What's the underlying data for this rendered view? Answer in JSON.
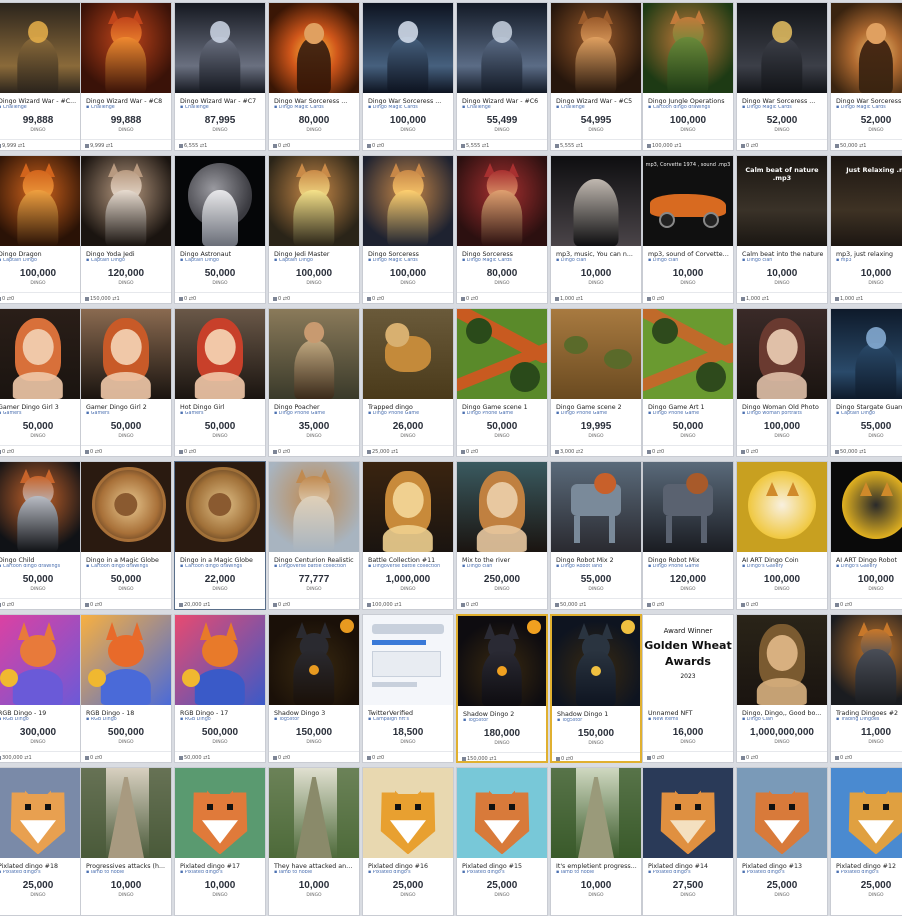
{
  "rows": [
    [
      {
        "title": "Dingo Wizard War - #C...",
        "collection": "Challenge",
        "price": "99,888",
        "unit": "DINGO",
        "foot": "9,999 ⇄1",
        "art": "wizard",
        "c": [
          "#2b241c",
          "#8a6a3a",
          "#e8b04a"
        ]
      },
      {
        "title": "Dingo Wizard War - #C8",
        "collection": "Challenge",
        "price": "99,888",
        "unit": "DINGO",
        "foot": "9,999 ⇄1",
        "art": "fox",
        "c": [
          "#3a1208",
          "#c0441a",
          "#f08a30"
        ]
      },
      {
        "title": "Dingo Wizard War - #C7",
        "collection": "Challenge",
        "price": "87,995",
        "unit": "DINGO",
        "foot": "6,555 ⇄1",
        "art": "wizard",
        "c": [
          "#151820",
          "#6a7080",
          "#cfd8e8"
        ]
      },
      {
        "title": "Dingo War Sorceress ...",
        "collection": "Dingo Magic Cards",
        "price": "80,000",
        "unit": "DINGO",
        "foot": "0 ⇄0",
        "art": "fire",
        "c": [
          "#3a1605",
          "#d0561a",
          "#ffc340"
        ]
      },
      {
        "title": "Dingo War Sorceress ...",
        "collection": "Dingo Magic Cards",
        "price": "100,000",
        "unit": "DINGO",
        "foot": "0 ⇄0",
        "art": "wizard",
        "c": [
          "#0d1320",
          "#46607e",
          "#d8e2f0"
        ]
      },
      {
        "title": "Dingo Wizard War - #C6",
        "collection": "Challenge",
        "price": "55,499",
        "unit": "DINGO",
        "foot": "5,555 ⇄1",
        "art": "wizard",
        "c": [
          "#131a26",
          "#5b6c86",
          "#c8d2e0"
        ]
      },
      {
        "title": "Dingo Wizard War - #C5",
        "collection": "Challenge",
        "price": "54,995",
        "unit": "DINGO",
        "foot": "5,555 ⇄1",
        "art": "fox",
        "c": [
          "#26160c",
          "#9a5a2a",
          "#e0a060"
        ]
      },
      {
        "title": "Dingo Jungle Operations",
        "collection": "Cartoon dingo drawings",
        "price": "100,000",
        "unit": "DINGO",
        "foot": "100,000 ⇄1",
        "art": "fox",
        "c": [
          "#1d3a14",
          "#c27a3a",
          "#6a8a3a"
        ]
      },
      {
        "title": "Dingo War Sorceress ...",
        "collection": "Dingo Magic Cards",
        "price": "52,000",
        "unit": "DINGO",
        "foot": "0 ⇄0",
        "art": "wizard",
        "c": [
          "#121418",
          "#3c3f48",
          "#e6c060"
        ]
      },
      {
        "title": "Dingo War Sorceress",
        "collection": "Dingo Magic Cards",
        "price": "52,000",
        "unit": "DINGO",
        "foot": "50,000 ⇄1",
        "art": "fire",
        "c": [
          "#3a2410",
          "#b06a30",
          "#f0c070"
        ]
      }
    ],
    [
      {
        "title": "Dingo Dragon",
        "collection": "Captain Dingo",
        "price": "100,000",
        "unit": "DINGO",
        "foot": "0 ⇄0",
        "art": "fox",
        "c": [
          "#2a1206",
          "#d2641c",
          "#f0a040"
        ]
      },
      {
        "title": "Dingo Yoda Jedi",
        "collection": "Captain Dingo",
        "price": "120,000",
        "unit": "DINGO",
        "foot": "150,000 ⇄1",
        "art": "fox",
        "c": [
          "#1a1410",
          "#b89a80",
          "#e8dcd0"
        ]
      },
      {
        "title": "Dingo Astronaut",
        "collection": "Captain Dingo",
        "price": "50,000",
        "unit": "DINGO",
        "foot": "0 ⇄0",
        "art": "space",
        "c": [
          "#050608",
          "#6a6e78",
          "#e8e8ea"
        ]
      },
      {
        "title": "Dingo Jedi Master",
        "collection": "Captain Dingo",
        "price": "100,000",
        "unit": "DINGO",
        "foot": "0 ⇄0",
        "art": "fox",
        "c": [
          "#2a2418",
          "#c98a48",
          "#f6e28a"
        ]
      },
      {
        "title": "Dingo Sorceress",
        "collection": "Dingo Magic Cards",
        "price": "100,000",
        "unit": "DINGO",
        "foot": "0 ⇄0",
        "art": "fox",
        "c": [
          "#1e2230",
          "#c88848",
          "#ffd070"
        ]
      },
      {
        "title": "Dingo Sorceress",
        "collection": "Dingo Magic Cards",
        "price": "80,000",
        "unit": "DINGO",
        "foot": "0 ⇄0",
        "art": "fox",
        "c": [
          "#2c1010",
          "#a83030",
          "#e0a070"
        ]
      },
      {
        "title": "mp3, music, You can n...",
        "collection": "Dingo clan",
        "price": "10,000",
        "unit": "DINGO",
        "foot": "1,000 ⇄1",
        "art": "dark",
        "c": [
          "#0e0e10",
          "#4a4448",
          "#c0b8b0"
        ]
      },
      {
        "title": "mp3, sound of Corvette ...",
        "collection": "Dingo clan",
        "price": "10,000",
        "unit": "DINGO",
        "foot": "0 ⇄0",
        "art": "car",
        "c": [
          "#101010",
          "#d86a20",
          "#f0f0f0"
        ]
      },
      {
        "title": "Calm beat into the nature",
        "collection": "Dingo clan",
        "price": "10,000",
        "unit": "DINGO",
        "foot": "1,000 ⇄1",
        "art": "textdark",
        "c": [
          "#1a1612",
          "#3a3228",
          "#ffffff"
        ],
        "txt": "Calm beat of nature .mp3"
      },
      {
        "title": "mp3, just relaxing",
        "collection": "mp3",
        "price": "10,000",
        "unit": "DINGO",
        "foot": "1,000 ⇄1",
        "art": "textdark",
        "c": [
          "#1c1612",
          "#3e3224",
          "#ffffff"
        ],
        "txt": "Just Relaxing .m"
      }
    ],
    [
      {
        "title": "Gamer Dingo Girl 3",
        "collection": "Gamers",
        "price": "50,000",
        "unit": "DINGO",
        "foot": "0 ⇄0",
        "art": "girl",
        "c": [
          "#2a1e18",
          "#d8703a",
          "#f0c8a8"
        ]
      },
      {
        "title": "Gamer Dingo Girl 2",
        "collection": "Gamers",
        "price": "50,000",
        "unit": "DINGO",
        "foot": "0 ⇄0",
        "art": "girl",
        "c": [
          "#8a6a50",
          "#c85a28",
          "#f0c8a8"
        ]
      },
      {
        "title": "Hot Dingo Girl",
        "collection": "Gamers",
        "price": "50,000",
        "unit": "DINGO",
        "foot": "0 ⇄0",
        "art": "girl",
        "c": [
          "#6a5848",
          "#c8402a",
          "#f2c8a8"
        ]
      },
      {
        "title": "Dingo Poacher",
        "collection": "Dingo Phone Game",
        "price": "35,000",
        "unit": "DINGO",
        "foot": "0 ⇄0",
        "art": "man",
        "c": [
          "#3a3a2a",
          "#8a7a5a",
          "#c0a880"
        ]
      },
      {
        "title": "Trapped dingo",
        "collection": "Dingo Phone Game",
        "price": "26,000",
        "unit": "DINGO",
        "foot": "25,000 ⇄1",
        "art": "dog",
        "c": [
          "#4a3a1a",
          "#c48a3a",
          "#d8b070"
        ]
      },
      {
        "title": "Dingo Game scene 1",
        "collection": "Dingo Phone Game",
        "price": "50,000",
        "unit": "DINGO",
        "foot": "0 ⇄0",
        "art": "map",
        "c": [
          "#2a4a1a",
          "#c85a20",
          "#5a8a2a"
        ]
      },
      {
        "title": "Dingo Game scene 2",
        "collection": "Dingo Phone Game",
        "price": "19,995",
        "unit": "DINGO",
        "foot": "3,000 ⇄2",
        "art": "savanna",
        "c": [
          "#6a4a20",
          "#a87a40",
          "#5a6a2a"
        ]
      },
      {
        "title": "Dingo Game Art 1",
        "collection": "Dingo Phone Game",
        "price": "50,000",
        "unit": "DINGO",
        "foot": "0 ⇄0",
        "art": "map",
        "c": [
          "#2e4a1c",
          "#c06a2a",
          "#6a9a30"
        ]
      },
      {
        "title": "Dingo Woman Old Photo",
        "collection": "Dingo woman portraits",
        "price": "100,000",
        "unit": "DINGO",
        "foot": "0 ⇄0",
        "art": "girl",
        "c": [
          "#3a2a28",
          "#6a3a30",
          "#e0c0a8"
        ]
      },
      {
        "title": "Dingo Stargate Guardi...",
        "collection": "Captain Dingo",
        "price": "55,000",
        "unit": "DINGO",
        "foot": "50,000 ⇄1",
        "art": "wizard",
        "c": [
          "#0e1a2a",
          "#2a4a6a",
          "#8ab0d8"
        ]
      }
    ],
    [
      {
        "title": "Dingo Child",
        "collection": "Cartoon dingo drawings",
        "price": "50,000",
        "unit": "DINGO",
        "foot": "0 ⇄0",
        "art": "fox",
        "c": [
          "#101216",
          "#c8642a",
          "#b8bcc4"
        ]
      },
      {
        "title": "Dingo in a Magic Globe",
        "collection": "Cartoon dingo drawings",
        "price": "50,000",
        "unit": "DINGO",
        "foot": "0 ⇄0",
        "art": "globe",
        "c": [
          "#2a1a10",
          "#a87038",
          "#e8c890"
        ]
      },
      {
        "title": "Dingo in a Magic Globe",
        "collection": "Cartoon dingo drawings",
        "price": "22,000",
        "unit": "DINGO",
        "foot": "20,000 ⇄1",
        "art": "globe",
        "c": [
          "#2a1a10",
          "#a07038",
          "#e0c088"
        ],
        "hl": true
      },
      {
        "title": "Dingo Centurion Realistic",
        "collection": "Dingoverse battle collection",
        "price": "77,777",
        "unit": "DINGO",
        "foot": "0 ⇄0",
        "art": "fox",
        "c": [
          "#a8b4c0",
          "#c08a50",
          "#e0d0b8"
        ]
      },
      {
        "title": "Battle Collection #11",
        "collection": "Dingoverse battle collection",
        "price": "1,000,000",
        "unit": "DINGO",
        "foot": "100,000 ⇄1",
        "art": "girl",
        "c": [
          "#3a2410",
          "#c88a3a",
          "#f0d090"
        ]
      },
      {
        "title": "Mix to the river",
        "collection": "Dingo clan",
        "price": "250,000",
        "unit": "DINGO",
        "foot": "0 ⇄0",
        "art": "girl",
        "c": [
          "#3a5a60",
          "#c08040",
          "#e8c8a0"
        ]
      },
      {
        "title": "Dingo Robot Mix 2",
        "collection": "Dingo Robot land",
        "price": "55,000",
        "unit": "DINGO",
        "foot": "50,000 ⇄1",
        "art": "robot",
        "c": [
          "#2a2a30",
          "#c8602a",
          "#7a8a9a"
        ]
      },
      {
        "title": "Dingo Robot Mix",
        "collection": "Dingo Phone Game",
        "price": "120,000",
        "unit": "DINGO",
        "foot": "0 ⇄0",
        "art": "robot",
        "c": [
          "#1a1c22",
          "#a85a2a",
          "#5a6270"
        ]
      },
      {
        "title": "AI ART Dingo Coin",
        "collection": "Dingo's Gallery",
        "price": "100,000",
        "unit": "DINGO",
        "foot": "0 ⇄0",
        "art": "coin",
        "c": [
          "#c8a020",
          "#f0c840",
          "#f8f0e0"
        ]
      },
      {
        "title": "AI ART Dingo Robot",
        "collection": "Dingo's Gallery",
        "price": "100,000",
        "unit": "DINGO",
        "foot": "0 ⇄0",
        "art": "coin",
        "c": [
          "#0a0a0a",
          "#e0b020",
          "#2a2a2a"
        ]
      }
    ],
    [
      {
        "title": "RGB Dingo - 19",
        "collection": "RGB Dingo",
        "price": "300,000",
        "unit": "DINGO",
        "foot": "300,000 ⇄1",
        "art": "cartoon",
        "c": [
          "#e040a0",
          "#e87a3a",
          "#6a5ad8"
        ]
      },
      {
        "title": "RGB Dingo - 18",
        "collection": "RGB Dingo",
        "price": "500,000",
        "unit": "DINGO",
        "foot": "0 ⇄0",
        "art": "cartoon",
        "c": [
          "#f8b040",
          "#e86a2a",
          "#4a6ad8"
        ]
      },
      {
        "title": "RGB Dingo - 17",
        "collection": "RGB Dingo",
        "price": "500,000",
        "unit": "DINGO",
        "foot": "50,000 ⇄1",
        "art": "cartoon",
        "c": [
          "#e84a70",
          "#e87a2a",
          "#3a5ac8"
        ]
      },
      {
        "title": "Shadow Dingo 3",
        "collection": "Tog5stor",
        "price": "150,000",
        "unit": "DINGO",
        "foot": "0 ⇄0",
        "art": "shadow",
        "c": [
          "#1a1008",
          "#e89a20",
          "#2a2a30"
        ]
      },
      {
        "title": "TwitterVerified",
        "collection": "Campaign nft's",
        "price": "18,500",
        "unit": "DINGO",
        "foot": "0 ⇄0",
        "art": "web",
        "c": [
          "#f4f6fa",
          "#3a7ad8",
          "#c8d0dc"
        ]
      },
      {
        "title": "Shadow Dingo 2",
        "collection": "Tog5stor",
        "price": "180,000",
        "unit": "DINGO",
        "foot": "150,000 ⇄1",
        "art": "shadow",
        "c": [
          "#0e0c10",
          "#f0a020",
          "#2a2a34"
        ],
        "gold": true
      },
      {
        "title": "Shadow Dingo 1",
        "collection": "Tog5stor",
        "price": "150,000",
        "unit": "DINGO",
        "foot": "0 ⇄0",
        "art": "shadow",
        "c": [
          "#0e1420",
          "#f0c040",
          "#2a3440"
        ],
        "gold": true
      },
      {
        "title": "Unnamed NFT",
        "collection": "New Items",
        "price": "16,000",
        "unit": "DINGO",
        "foot": "0 ⇄0",
        "art": "award",
        "c": [
          "#ffffff",
          "#111111",
          "#111111"
        ],
        "txt": "Award Winner",
        "txt2": "Golden Wheat",
        "txt3": "Awards",
        "txt4": "2023"
      },
      {
        "title": "Dingo, Dingo,, Good bo...",
        "collection": "Dingo Clan",
        "price": "1,000,000,000",
        "unit": "DINGO",
        "foot": "0 ⇄0",
        "art": "girl",
        "c": [
          "#2a2418",
          "#7a5a30",
          "#d8b080"
        ]
      },
      {
        "title": "Trading Dingoes #2",
        "collection": "Trading Dingoes",
        "price": "11,000",
        "unit": "DINGO",
        "foot": "0 ⇄0",
        "art": "fox",
        "c": [
          "#1a1c20",
          "#c8782a",
          "#4a4e58"
        ]
      }
    ],
    [
      {
        "title": "Pixlated dingo #18",
        "collection": "Pixlated dingo's",
        "price": "25,000",
        "unit": "DINGO",
        "foot": "",
        "art": "pixel",
        "c": [
          "#7a8aa8",
          "#e8a050",
          "#ffffff"
        ]
      },
      {
        "title": "Progressives attacks (h...",
        "collection": "Iamb to noble",
        "price": "10,000",
        "unit": "DINGO",
        "foot": "",
        "art": "path",
        "c": [
          "#4a5a3a",
          "#a89a80",
          "#d8d0c0"
        ]
      },
      {
        "title": "Pixlated dingo #17",
        "collection": "Pixlated dingo's",
        "price": "10,000",
        "unit": "DINGO",
        "foot": "",
        "art": "pixel",
        "c": [
          "#5a9a70",
          "#e07a3a",
          "#ffffff"
        ]
      },
      {
        "title": "They have attacked and...",
        "collection": "Iamb to noble",
        "price": "10,000",
        "unit": "DINGO",
        "foot": "",
        "art": "path",
        "c": [
          "#4e6a3a",
          "#8a8a6a",
          "#e0e0d0"
        ]
      },
      {
        "title": "Pixlated dingo #16",
        "collection": "Pixlated dingo's",
        "price": "25,000",
        "unit": "DINGO",
        "foot": "",
        "art": "pixel",
        "c": [
          "#e8d8b0",
          "#e8a030",
          "#ffffff"
        ]
      },
      {
        "title": "Pixlated dingo #15",
        "collection": "Pixlated dingo's",
        "price": "25,000",
        "unit": "DINGO",
        "foot": "",
        "art": "pixel",
        "c": [
          "#78c8d8",
          "#d87a3a",
          "#ffffff"
        ]
      },
      {
        "title": "It's empletient progress...",
        "collection": "Iamb to noble",
        "price": "10,000",
        "unit": "DINGO",
        "foot": "",
        "art": "path",
        "c": [
          "#3a5a2a",
          "#9a9a7a",
          "#cfd8c0"
        ]
      },
      {
        "title": "Pixlated dingo #14",
        "collection": "Pixlated dingo's",
        "price": "27,500",
        "unit": "DINGO",
        "foot": "",
        "art": "pixel",
        "c": [
          "#2a3a58",
          "#e09040",
          "#f4e0c0"
        ]
      },
      {
        "title": "Pixlated dingo #13",
        "collection": "Pixlated dingo's",
        "price": "25,000",
        "unit": "DINGO",
        "foot": "",
        "art": "pixel",
        "c": [
          "#7a9ab8",
          "#d87a3a",
          "#ffffff"
        ]
      },
      {
        "title": "Pixlated dingo #12",
        "collection": "Pixlated dingo's",
        "price": "25,000",
        "unit": "DINGO",
        "foot": "",
        "art": "pixel",
        "c": [
          "#4a8ad0",
          "#e0a040",
          "#ffffff"
        ]
      }
    ]
  ]
}
